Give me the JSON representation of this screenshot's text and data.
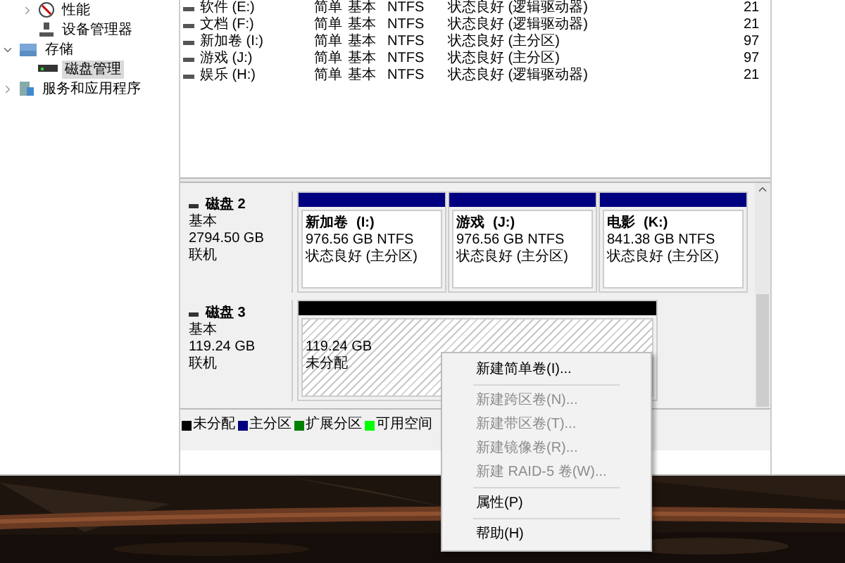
{
  "tree": [
    {
      "children": [
        {
          "label": "性能",
          "expanded": false,
          "selected": false
        },
        {
          "label": "设备管理器",
          "selected": false
        }
      ]
    },
    {
      "label": "存储",
      "expanded": true,
      "selected": false,
      "children": [
        {
          "label": "磁盘管理",
          "selected": true
        }
      ]
    },
    {
      "label": "服务和应用程序",
      "expanded": false,
      "selected": false
    }
  ],
  "volumes": [
    {
      "name": "软件 (E:)",
      "layout": "简单",
      "type": "基本",
      "fs": "NTFS",
      "status": "状态良好 (逻辑驱动器)",
      "column_6": "21"
    },
    {
      "name": "文档 (F:)",
      "layout": "简单",
      "type": "基本",
      "fs": "NTFS",
      "status": "状态良好 (逻辑驱动器)",
      "column_6": "21"
    },
    {
      "name": "新加卷 (I:)",
      "layout": "简单",
      "type": "基本",
      "fs": "NTFS",
      "status": "状态良好 (主分区)",
      "column_6": "97"
    },
    {
      "name": "游戏 (J:)",
      "layout": "简单",
      "type": "基本",
      "fs": "NTFS",
      "status": "状态良好 (主分区)",
      "column_6": "97"
    },
    {
      "name": "娱乐 (H:)",
      "layout": "简单",
      "type": "基本",
      "fs": "NTFS",
      "status": "状态良好 (逻辑驱动器)",
      "column_6": "21"
    }
  ],
  "disks": [
    {
      "name": "磁盘 2",
      "type": "基本",
      "size": "2794.50 GB",
      "state": "联机",
      "partitions": [
        {
          "kind": "primary",
          "name": "新加卷",
          "letter": "(I:)",
          "size": "976.56 GB NTFS",
          "status": "状态良好 (主分区)"
        },
        {
          "kind": "primary",
          "name": "游戏",
          "letter": "(J:)",
          "size": "976.56 GB NTFS",
          "status": "状态良好 (主分区)"
        },
        {
          "kind": "primary",
          "name": "电影",
          "letter": "(K:)",
          "size": "841.38 GB NTFS",
          "status": "状态良好 (主分区)"
        }
      ]
    },
    {
      "name": "磁盘 3",
      "type": "基本",
      "size": "119.24 GB",
      "state": "联机",
      "partitions": [
        {
          "kind": "unallocated",
          "size": "119.24 GB",
          "status": "未分配"
        }
      ]
    }
  ],
  "legend": [
    {
      "label": "未分配",
      "color": "#000000"
    },
    {
      "label": "主分区",
      "color": "#000080"
    },
    {
      "label": "扩展分区",
      "color": "#008000"
    },
    {
      "label": "可用空间",
      "color": "#00ff00"
    }
  ],
  "context_menu": [
    {
      "kind": "item",
      "label": "新建简单卷(I)...",
      "disabled": false
    },
    {
      "kind": "separator"
    },
    {
      "kind": "item",
      "label": "新建跨区卷(N)...",
      "disabled": true
    },
    {
      "kind": "item",
      "label": "新建带区卷(T)...",
      "disabled": true
    },
    {
      "kind": "item",
      "label": "新建镜像卷(R)...",
      "disabled": true
    },
    {
      "kind": "item",
      "label": "新建 RAID-5 卷(W)...",
      "disabled": true
    },
    {
      "kind": "separator"
    },
    {
      "kind": "item",
      "label": "属性(P)",
      "disabled": false
    },
    {
      "kind": "separator"
    },
    {
      "kind": "item",
      "label": "帮助(H)",
      "disabled": false
    }
  ]
}
